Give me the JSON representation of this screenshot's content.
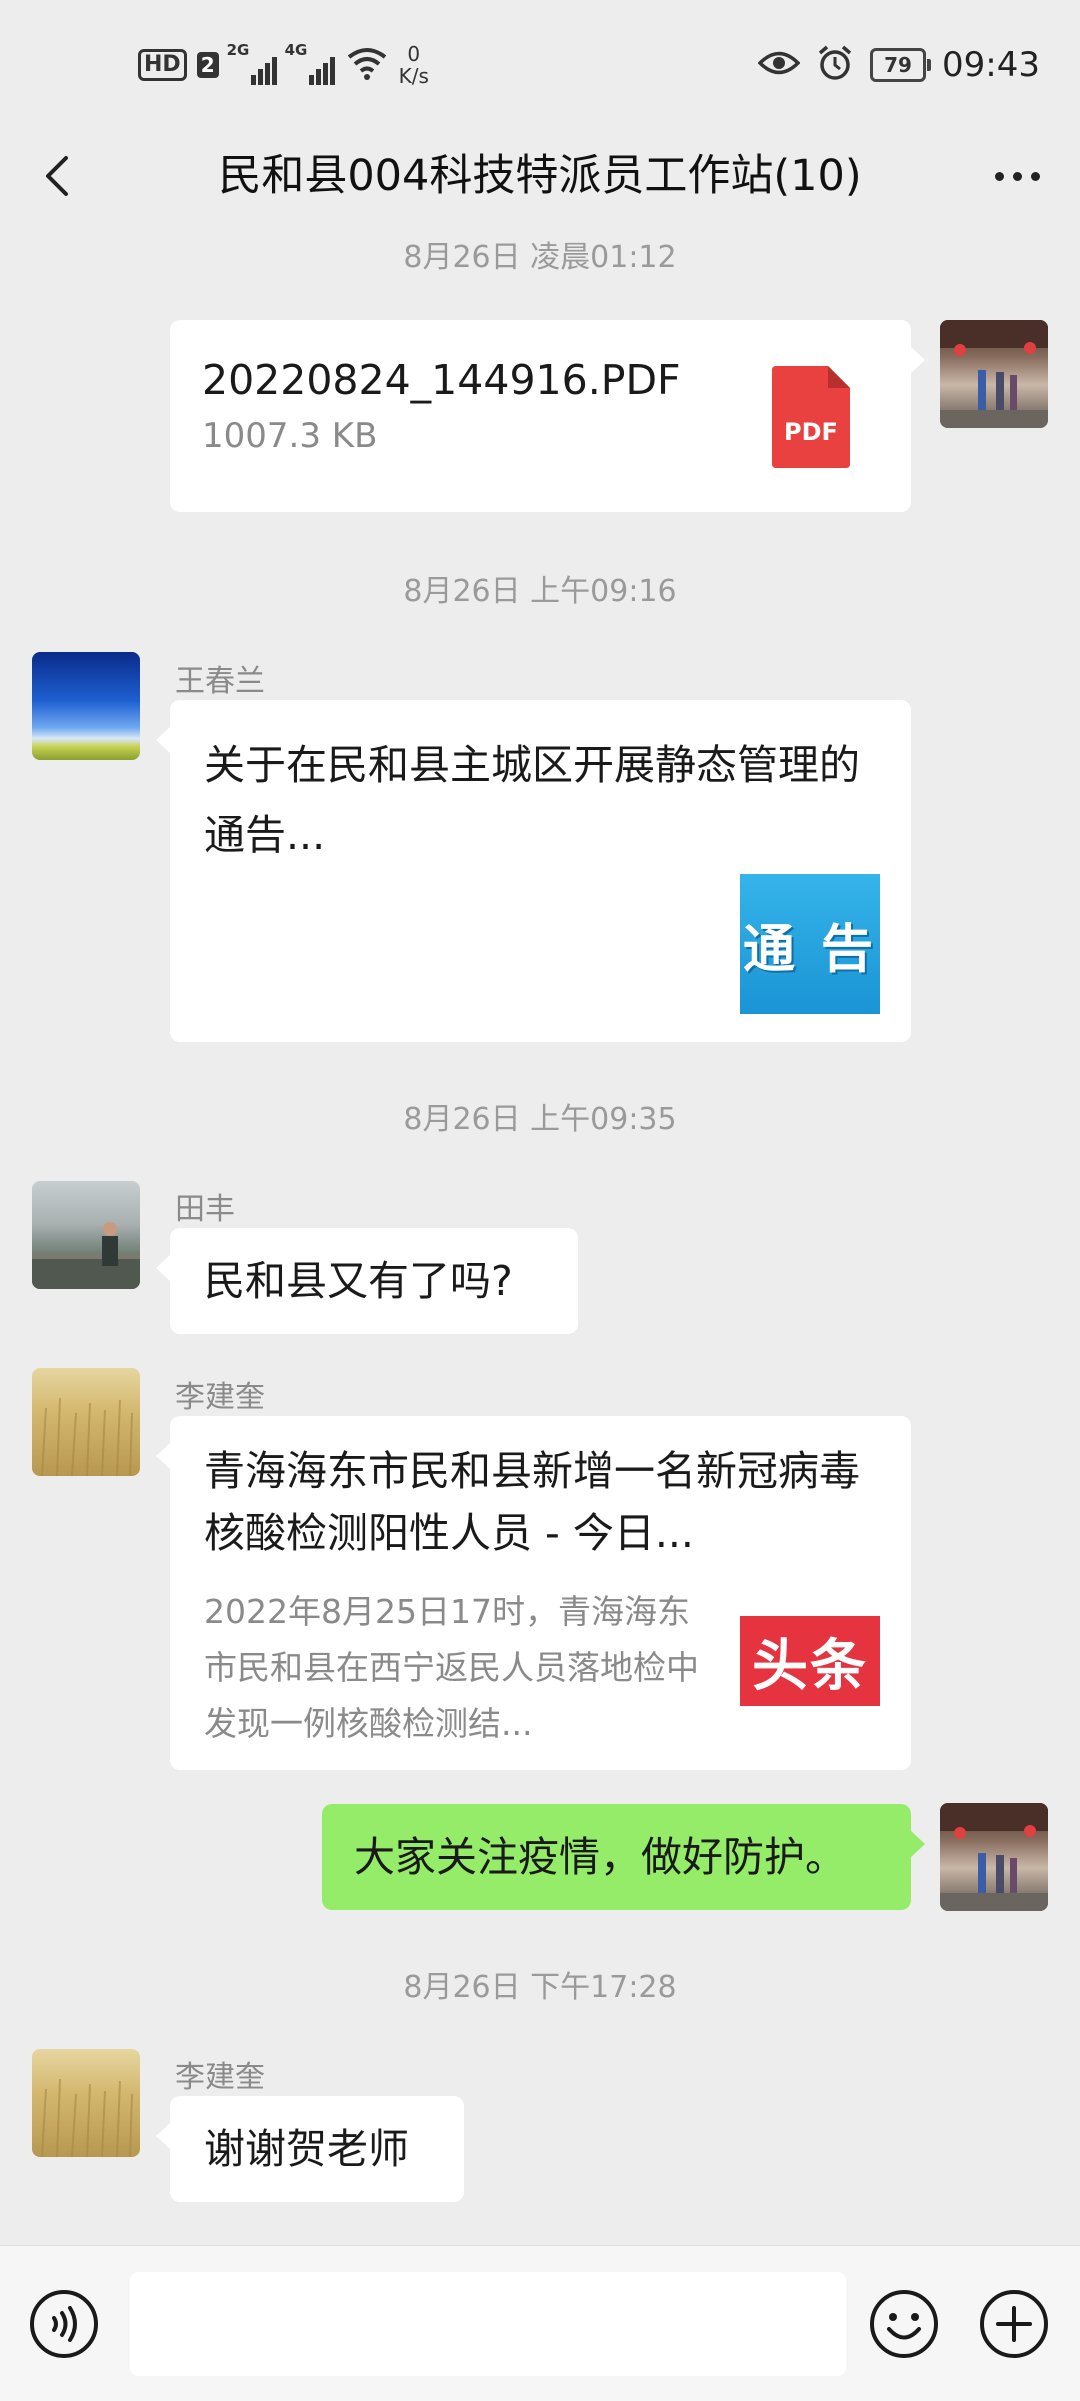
{
  "status_bar": {
    "hd_label": "HD",
    "sim_label": "2",
    "network_1": "2G",
    "network_2": "4G",
    "speed_value": "0",
    "speed_unit": "K/s",
    "battery_level": "79",
    "time": "09:43"
  },
  "header": {
    "title": "民和县004科技特派员工作站(10)"
  },
  "messages": [
    {
      "timestamp": "8月26日 凌晨01:12"
    },
    {
      "file_name": "20220824_144916.PDF",
      "file_size": "1007.3 KB",
      "file_icon_label": "PDF"
    },
    {
      "timestamp": "8月26日 上午09:16"
    },
    {
      "sender": "王春兰",
      "link_title": "关于在民和县主城区开展静态管理的通告...",
      "thumb_text": "通 告"
    },
    {
      "timestamp": "8月26日 上午09:35"
    },
    {
      "sender": "田丰",
      "text": "民和县又有了吗?"
    },
    {
      "sender": "李建奎",
      "link_title": "青海海东市民和县新增一名新冠病毒核酸检测阳性人员 - 今日...",
      "link_desc": "2022年8月25日17时，青海海东市民和县在西宁返民人员落地检中发现一例核酸检测结...",
      "thumb_text": "头条"
    },
    {
      "text": "大家关注疫情，做好防护。"
    },
    {
      "timestamp": "8月26日 下午17:28"
    },
    {
      "sender": "李建奎",
      "text": "谢谢贺老师"
    }
  ],
  "input_bar": {
    "placeholder": ""
  },
  "colors": {
    "background": "#ededed",
    "own_bubble": "#95ec69",
    "pdf_red": "#e8413f",
    "toutiao_red": "#e5333f",
    "notice_blue": "#1e9fd8"
  }
}
